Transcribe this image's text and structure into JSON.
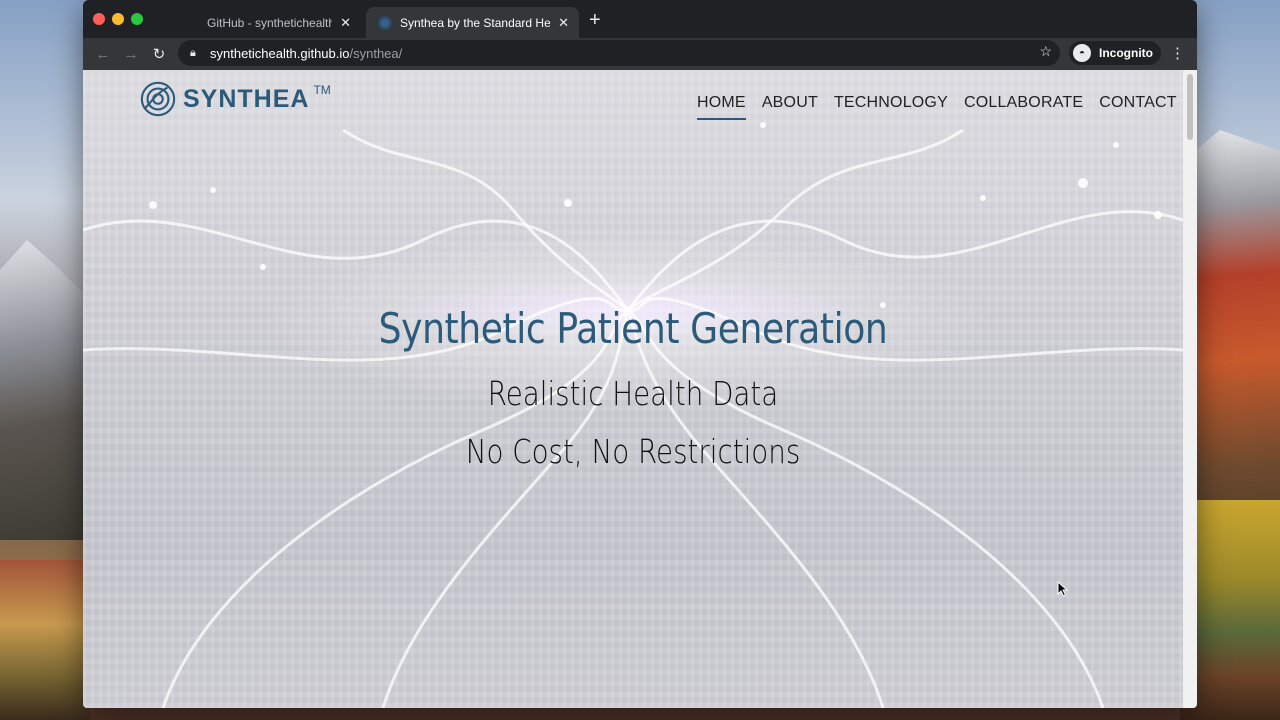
{
  "browser": {
    "tabs": [
      {
        "title": "GitHub - synthetichealth/synthea",
        "active": false
      },
      {
        "title": "Synthea by the Standard Health Record",
        "active": true
      }
    ],
    "address": {
      "host": "synthetichealth.github.io",
      "path": "/synthea/"
    },
    "profile_label": "Incognito"
  },
  "site": {
    "logo_text": "SYNTHEA",
    "logo_tm": "TM",
    "nav": [
      "HOME",
      "ABOUT",
      "TECHNOLOGY",
      "COLLABORATE",
      "CONTACT"
    ],
    "active_nav": "HOME"
  },
  "hero": {
    "headline": "Synthetic Patient Generation",
    "line1": "Realistic Health Data",
    "line2": "No Cost, No Restrictions"
  },
  "colors": {
    "brand": "#2b5a7a",
    "chrome_dark": "#202124",
    "chrome_toolbar": "#35363a"
  },
  "icons": {
    "back": "arrow-left-icon",
    "forward": "arrow-right-icon",
    "reload": "reload-icon",
    "lock": "lock-icon",
    "star": "star-icon",
    "menu": "kebab-menu-icon",
    "close": "close-icon",
    "new_tab": "plus-icon"
  }
}
